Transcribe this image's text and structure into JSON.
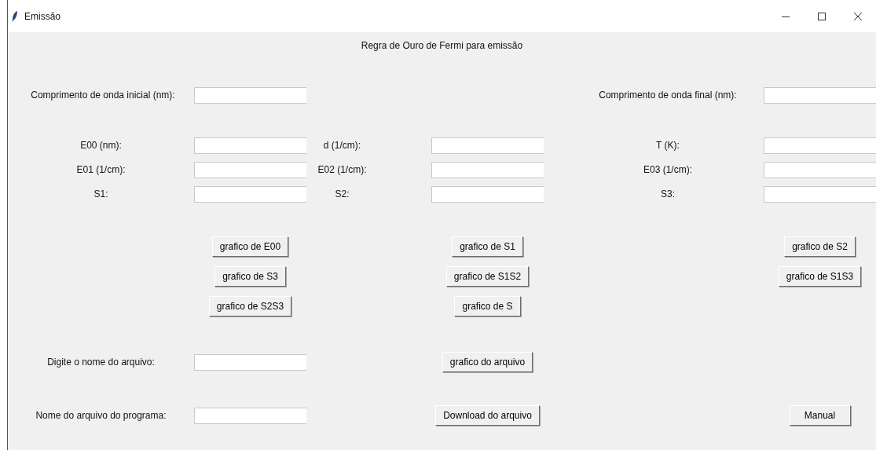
{
  "window": {
    "title": "Emissão"
  },
  "heading": "Regra de Ouro de Fermi para emissão",
  "wavelength_fields": [
    {
      "label": "Comprimento de onda inicial (nm):"
    },
    {
      "label": "Comprimento de onda final (nm):"
    }
  ],
  "parameter_rows": [
    [
      {
        "label": "E00 (nm):"
      },
      {
        "label": "d (1/cm):"
      },
      {
        "label": "T (K):"
      }
    ],
    [
      {
        "label": "E01 (1/cm):"
      },
      {
        "label": "E02 (1/cm):"
      },
      {
        "label": "E03 (1/cm):"
      }
    ],
    [
      {
        "label": "S1:"
      },
      {
        "label": "S2:"
      },
      {
        "label": "S3:"
      }
    ]
  ],
  "plot_button_rows": [
    [
      "grafico de E00",
      "grafico de S1",
      "grafico de S2"
    ],
    [
      "grafico de S3",
      "grafico de S1S2",
      "grafico de S1S3"
    ],
    [
      "grafico de S2S3",
      "grafico de S"
    ]
  ],
  "file_rows": [
    {
      "label": "Digite o nome do arquivo:",
      "button": "grafico do arquivo"
    },
    {
      "label": "Nome do arquivo do programa:",
      "button": "Download do arquivo"
    }
  ],
  "manual_button": "Manual"
}
